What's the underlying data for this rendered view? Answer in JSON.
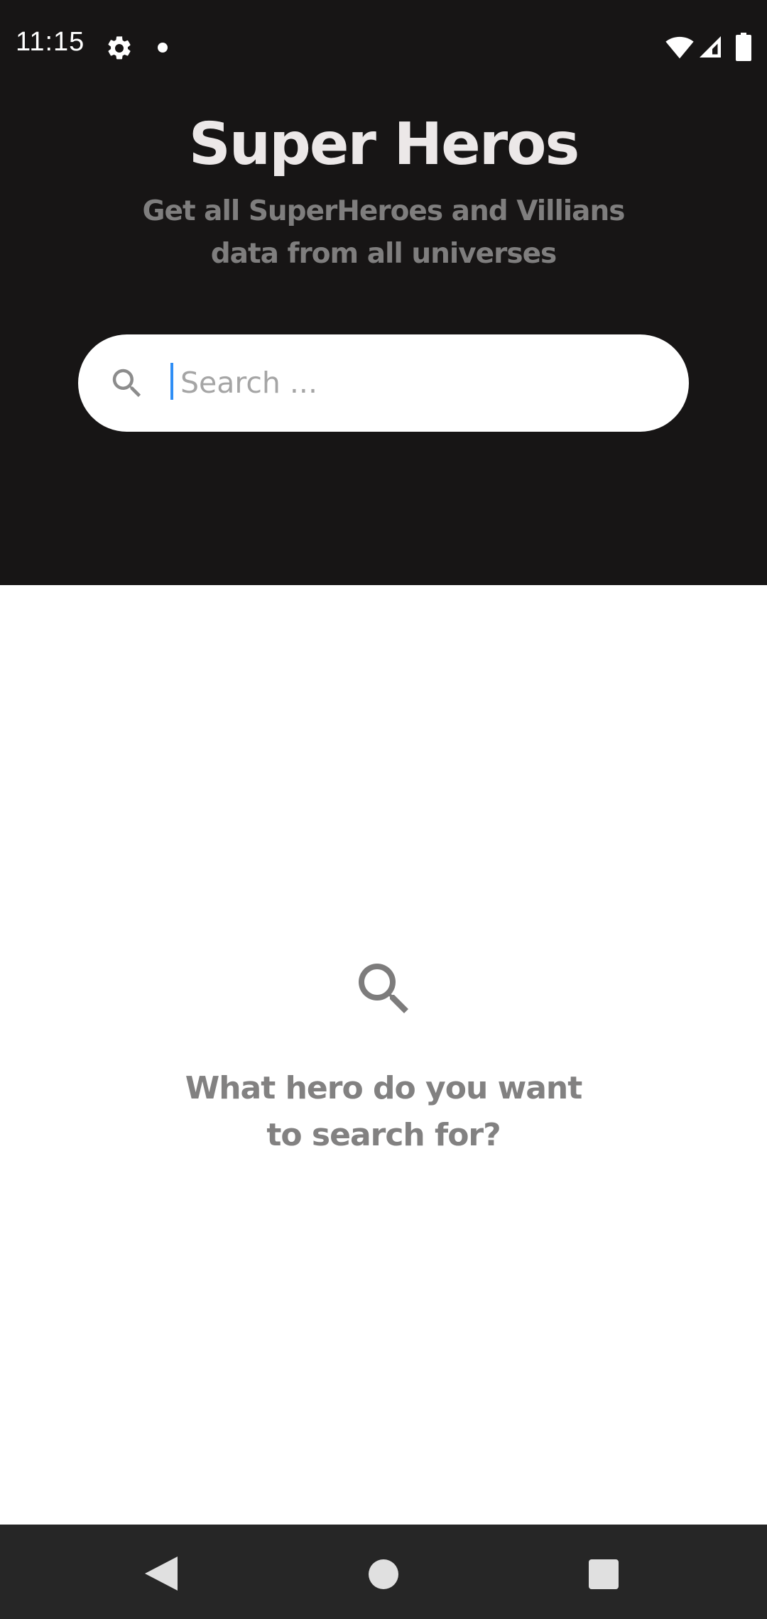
{
  "status_bar": {
    "time": "11:15",
    "icons": [
      "gear-icon",
      "notification-dot-icon",
      "wifi-icon",
      "signal-icon",
      "battery-icon"
    ]
  },
  "header": {
    "title": "Super Heros",
    "subtitle": "Get all SuperHeroes and Villians data from all universes",
    "background_color": "#171515"
  },
  "search": {
    "placeholder": "Search ...",
    "value": "",
    "icon": "search-icon"
  },
  "empty_state": {
    "icon": "search-icon",
    "message": "What hero do you want to search for?"
  },
  "nav_bar": {
    "buttons": [
      "back-icon",
      "home-icon",
      "recent-apps-icon"
    ]
  },
  "colors": {
    "accent_caret": "#2f8ef5",
    "muted_text": "#828181"
  }
}
